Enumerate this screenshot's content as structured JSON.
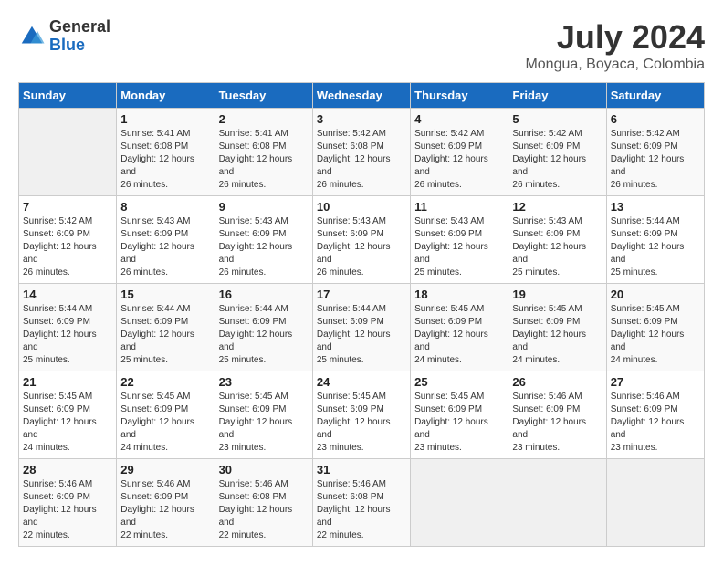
{
  "header": {
    "logo_general": "General",
    "logo_blue": "Blue",
    "month_year": "July 2024",
    "location": "Mongua, Boyaca, Colombia"
  },
  "calendar": {
    "days_of_week": [
      "Sunday",
      "Monday",
      "Tuesday",
      "Wednesday",
      "Thursday",
      "Friday",
      "Saturday"
    ],
    "weeks": [
      [
        {
          "day": "",
          "sunrise": "",
          "sunset": "",
          "daylight": ""
        },
        {
          "day": "1",
          "sunrise": "Sunrise: 5:41 AM",
          "sunset": "Sunset: 6:08 PM",
          "daylight": "Daylight: 12 hours and 26 minutes."
        },
        {
          "day": "2",
          "sunrise": "Sunrise: 5:41 AM",
          "sunset": "Sunset: 6:08 PM",
          "daylight": "Daylight: 12 hours and 26 minutes."
        },
        {
          "day": "3",
          "sunrise": "Sunrise: 5:42 AM",
          "sunset": "Sunset: 6:08 PM",
          "daylight": "Daylight: 12 hours and 26 minutes."
        },
        {
          "day": "4",
          "sunrise": "Sunrise: 5:42 AM",
          "sunset": "Sunset: 6:09 PM",
          "daylight": "Daylight: 12 hours and 26 minutes."
        },
        {
          "day": "5",
          "sunrise": "Sunrise: 5:42 AM",
          "sunset": "Sunset: 6:09 PM",
          "daylight": "Daylight: 12 hours and 26 minutes."
        },
        {
          "day": "6",
          "sunrise": "Sunrise: 5:42 AM",
          "sunset": "Sunset: 6:09 PM",
          "daylight": "Daylight: 12 hours and 26 minutes."
        }
      ],
      [
        {
          "day": "7",
          "sunrise": "Sunrise: 5:42 AM",
          "sunset": "Sunset: 6:09 PM",
          "daylight": "Daylight: 12 hours and 26 minutes."
        },
        {
          "day": "8",
          "sunrise": "Sunrise: 5:43 AM",
          "sunset": "Sunset: 6:09 PM",
          "daylight": "Daylight: 12 hours and 26 minutes."
        },
        {
          "day": "9",
          "sunrise": "Sunrise: 5:43 AM",
          "sunset": "Sunset: 6:09 PM",
          "daylight": "Daylight: 12 hours and 26 minutes."
        },
        {
          "day": "10",
          "sunrise": "Sunrise: 5:43 AM",
          "sunset": "Sunset: 6:09 PM",
          "daylight": "Daylight: 12 hours and 26 minutes."
        },
        {
          "day": "11",
          "sunrise": "Sunrise: 5:43 AM",
          "sunset": "Sunset: 6:09 PM",
          "daylight": "Daylight: 12 hours and 25 minutes."
        },
        {
          "day": "12",
          "sunrise": "Sunrise: 5:43 AM",
          "sunset": "Sunset: 6:09 PM",
          "daylight": "Daylight: 12 hours and 25 minutes."
        },
        {
          "day": "13",
          "sunrise": "Sunrise: 5:44 AM",
          "sunset": "Sunset: 6:09 PM",
          "daylight": "Daylight: 12 hours and 25 minutes."
        }
      ],
      [
        {
          "day": "14",
          "sunrise": "Sunrise: 5:44 AM",
          "sunset": "Sunset: 6:09 PM",
          "daylight": "Daylight: 12 hours and 25 minutes."
        },
        {
          "day": "15",
          "sunrise": "Sunrise: 5:44 AM",
          "sunset": "Sunset: 6:09 PM",
          "daylight": "Daylight: 12 hours and 25 minutes."
        },
        {
          "day": "16",
          "sunrise": "Sunrise: 5:44 AM",
          "sunset": "Sunset: 6:09 PM",
          "daylight": "Daylight: 12 hours and 25 minutes."
        },
        {
          "day": "17",
          "sunrise": "Sunrise: 5:44 AM",
          "sunset": "Sunset: 6:09 PM",
          "daylight": "Daylight: 12 hours and 25 minutes."
        },
        {
          "day": "18",
          "sunrise": "Sunrise: 5:45 AM",
          "sunset": "Sunset: 6:09 PM",
          "daylight": "Daylight: 12 hours and 24 minutes."
        },
        {
          "day": "19",
          "sunrise": "Sunrise: 5:45 AM",
          "sunset": "Sunset: 6:09 PM",
          "daylight": "Daylight: 12 hours and 24 minutes."
        },
        {
          "day": "20",
          "sunrise": "Sunrise: 5:45 AM",
          "sunset": "Sunset: 6:09 PM",
          "daylight": "Daylight: 12 hours and 24 minutes."
        }
      ],
      [
        {
          "day": "21",
          "sunrise": "Sunrise: 5:45 AM",
          "sunset": "Sunset: 6:09 PM",
          "daylight": "Daylight: 12 hours and 24 minutes."
        },
        {
          "day": "22",
          "sunrise": "Sunrise: 5:45 AM",
          "sunset": "Sunset: 6:09 PM",
          "daylight": "Daylight: 12 hours and 24 minutes."
        },
        {
          "day": "23",
          "sunrise": "Sunrise: 5:45 AM",
          "sunset": "Sunset: 6:09 PM",
          "daylight": "Daylight: 12 hours and 23 minutes."
        },
        {
          "day": "24",
          "sunrise": "Sunrise: 5:45 AM",
          "sunset": "Sunset: 6:09 PM",
          "daylight": "Daylight: 12 hours and 23 minutes."
        },
        {
          "day": "25",
          "sunrise": "Sunrise: 5:45 AM",
          "sunset": "Sunset: 6:09 PM",
          "daylight": "Daylight: 12 hours and 23 minutes."
        },
        {
          "day": "26",
          "sunrise": "Sunrise: 5:46 AM",
          "sunset": "Sunset: 6:09 PM",
          "daylight": "Daylight: 12 hours and 23 minutes."
        },
        {
          "day": "27",
          "sunrise": "Sunrise: 5:46 AM",
          "sunset": "Sunset: 6:09 PM",
          "daylight": "Daylight: 12 hours and 23 minutes."
        }
      ],
      [
        {
          "day": "28",
          "sunrise": "Sunrise: 5:46 AM",
          "sunset": "Sunset: 6:09 PM",
          "daylight": "Daylight: 12 hours and 22 minutes."
        },
        {
          "day": "29",
          "sunrise": "Sunrise: 5:46 AM",
          "sunset": "Sunset: 6:09 PM",
          "daylight": "Daylight: 12 hours and 22 minutes."
        },
        {
          "day": "30",
          "sunrise": "Sunrise: 5:46 AM",
          "sunset": "Sunset: 6:08 PM",
          "daylight": "Daylight: 12 hours and 22 minutes."
        },
        {
          "day": "31",
          "sunrise": "Sunrise: 5:46 AM",
          "sunset": "Sunset: 6:08 PM",
          "daylight": "Daylight: 12 hours and 22 minutes."
        },
        {
          "day": "",
          "sunrise": "",
          "sunset": "",
          "daylight": ""
        },
        {
          "day": "",
          "sunrise": "",
          "sunset": "",
          "daylight": ""
        },
        {
          "day": "",
          "sunrise": "",
          "sunset": "",
          "daylight": ""
        }
      ]
    ]
  }
}
